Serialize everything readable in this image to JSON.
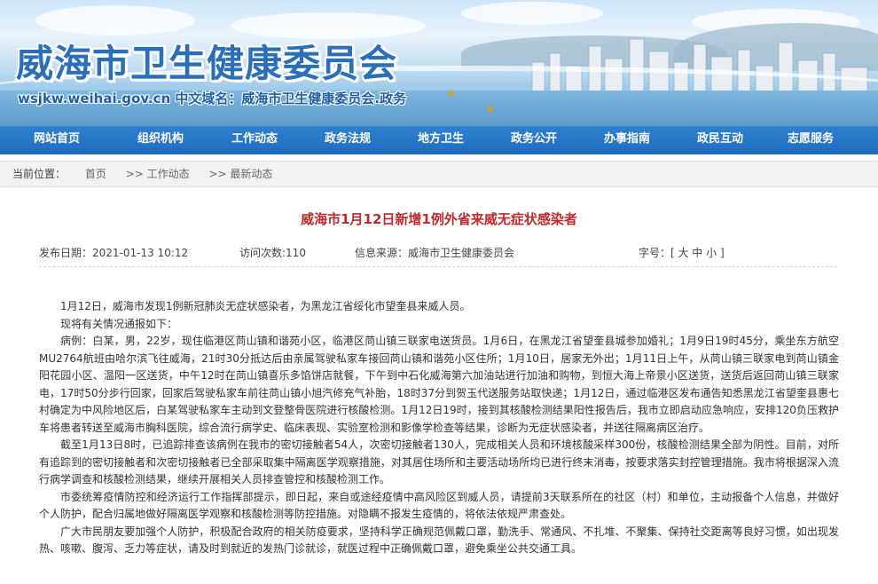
{
  "header": {
    "site_title": "威海市卫生健康委员会",
    "site_domain": "wsjkw.weihai.gov.cn  中文域名：威海市卫生健康委员会.政务"
  },
  "nav": {
    "items": [
      "网站首页",
      "组织机构",
      "工作动态",
      "政务法规",
      "地方卫生",
      "政务公开",
      "办事指南",
      "政民互动",
      "志愿服务"
    ]
  },
  "breadcrumb": {
    "label": "当前位置：",
    "items": [
      "首页",
      ">> 工作动态",
      ">> 最新动态"
    ]
  },
  "article": {
    "title": "威海市1月12日新增1例外省来威无症状感染者",
    "publish_date": "发布日期：2021-01-13 10:12",
    "visits": "访问次数:110",
    "source": "信息来源：威海市卫生健康委员会",
    "font_size": "字号：[ 大 中 小 ]",
    "paragraphs": [
      "1月12日，威海市发现1例新冠肺炎无症状感染者，为黑龙江省绥化市望奎县来威人员。",
      "现将有关情况通报如下：",
      "病例：白某，男，22岁，现住临港区苘山镇和谐苑小区，临港区苘山镇三联家电送货员。1月6日，在黑龙江省望奎县城参加婚礼；1月9日19时45分，乘坐东方航空MU2764航班由哈尔滨飞往威海，21时30分抵达后由亲属驾驶私家车接回苘山镇和谐苑小区住所；1月10日，居家无外出；1月11日上午，从苘山镇三联家电到苘山镇金阳花园小区、温阳一区送货，中午12时在苘山镇喜乐多馅饼店就餐，下午到中石化威海第六加油站进行加油和购物，到恒大海上帝景小区送货，送货后返回苘山镇三联家电，17时50分步行回家，回家后驾驶私家车前往苘山镇小旭汽修充气补胎，18时37分到贺玉代送服务站取快递；1月12日，通过临港区发布通告知悉黑龙江省望奎县惠七村确定为中风险地区后，白某驾驶私家车主动到文登整骨医院进行核酸检测。1月12日19时，接到其核酸检测结果阳性报告后，我市立即启动应急响应，安排120负压救护车将患者转送至威海市胸科医院，综合流行病学史、临床表现、实验室检测和影像学检查等结果，诊断为无症状感染者，并送往隔离病区治疗。",
      "截至1月13日8时，已追踪排查该病例在我市的密切接触者54人，次密切接触者130人，完成相关人员和环境核酸采样300份，核酸检测结果全部为阴性。目前，对所有追踪到的密切接触者和次密切接触者已全部采取集中隔离医学观察措施，对其居住场所和主要活动场所均已进行终末消毒，按要求落实封控管理措施。我市将根据深入流行病学调查和核酸检测结果，继续开展相关人员排查管控和核酸检测工作。",
      "市委统筹疫情防控和经济运行工作指挥部提示，即日起，来自或途经疫情中高风险区到威人员，请提前3天联系所在的社区（村）和单位，主动报备个人信息，并做好个人防护，配合归属地做好隔离医学观察和核酸检测等防控措施。对隐瞒不报发生疫情的，将依法依规严肃查处。",
      "广大市民朋友要加强个人防护，积极配合政府的相关防疫要求，坚持科学正确规范佩戴口罩，勤洗手、常通风、不扎堆、不聚集、保持社交距离等良好习惯，如出现发热、咳嗽、腹泻、乏力等症状，请及时到就近的发热门诊就诊，就医过程中正确佩戴口罩，避免乘坐公共交通工具。"
    ]
  },
  "colors": {
    "nav_bg": "#1f6dbf",
    "title_red": "#c0292b",
    "site_title_blue": "#2a6fb8"
  }
}
